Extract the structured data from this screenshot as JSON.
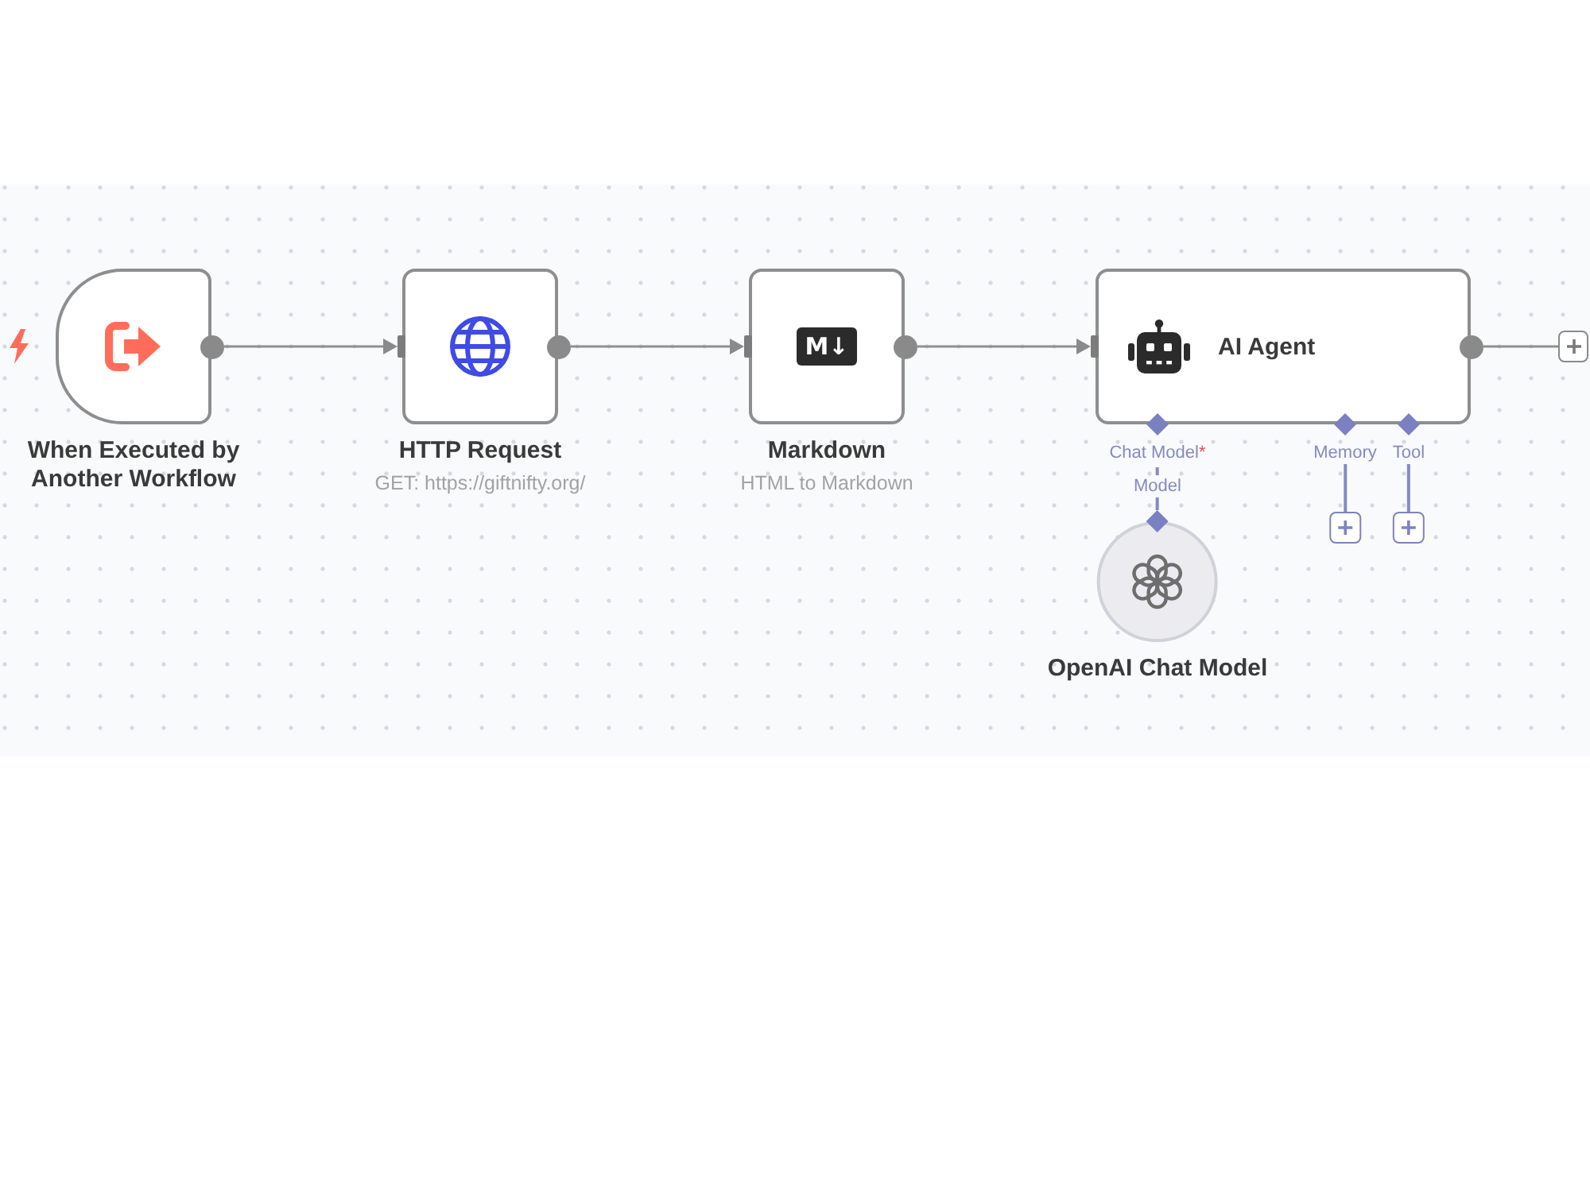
{
  "canvas": {
    "nodes": [
      {
        "kind": "trigger",
        "title": "When Executed by Another Workflow"
      },
      {
        "kind": "request",
        "title": "HTTP Request",
        "subtitle": "GET: https://giftnifty.org/"
      },
      {
        "kind": "markdown",
        "title": "Markdown",
        "subtitle": "HTML to Markdown",
        "icon_glyph": "M↓"
      },
      {
        "kind": "agent",
        "title": "AI Agent",
        "inputs": [
          {
            "label": "Chat Model",
            "required_mark": "*",
            "node": {
              "kind": "model",
              "port_label": "Model",
              "title": "OpenAI Chat Model"
            }
          },
          {
            "label": "Memory"
          },
          {
            "label": "Tool"
          }
        ]
      }
    ]
  }
}
